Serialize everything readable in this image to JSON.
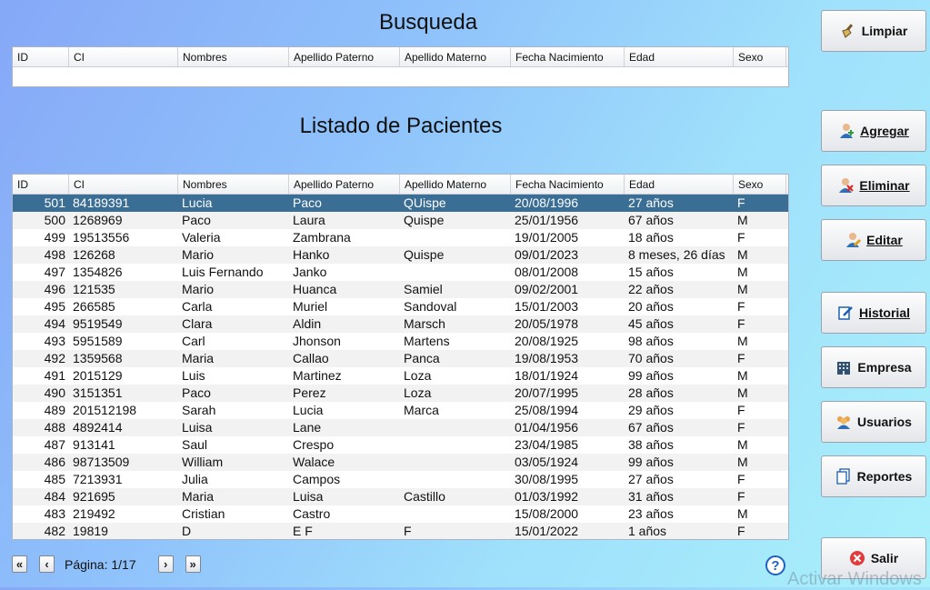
{
  "search": {
    "title": "Busqueda",
    "columns": [
      "ID",
      "CI",
      "Nombres",
      "Apellido Paterno",
      "Apellido Materno",
      "Fecha Nacimiento",
      "Edad",
      "Sexo"
    ]
  },
  "listing": {
    "title": "Listado de Pacientes",
    "columns": [
      "ID",
      "CI",
      "Nombres",
      "Apellido Paterno",
      "Apellido Materno",
      "Fecha Nacimiento",
      "Edad",
      "Sexo"
    ],
    "rows": [
      [
        "501",
        "84189391",
        "Lucia",
        "Paco",
        "QUispe",
        "20/08/1996",
        "27 años",
        "F"
      ],
      [
        "500",
        "1268969",
        "Paco",
        "Laura",
        "Quispe",
        "25/01/1956",
        "67 años",
        "M"
      ],
      [
        "499",
        "19513556",
        "Valeria",
        "Zambrana",
        "",
        "19/01/2005",
        "18 años",
        "F"
      ],
      [
        "498",
        "126268",
        "Mario",
        "Hanko",
        "Quispe",
        "09/01/2023",
        "8 meses, 26 días",
        "M"
      ],
      [
        "497",
        "1354826",
        "Luis Fernando",
        "Janko",
        "",
        "08/01/2008",
        "15 años",
        "M"
      ],
      [
        "496",
        "121535",
        "Mario",
        "Huanca",
        "Samiel",
        "09/02/2001",
        "22 años",
        "M"
      ],
      [
        "495",
        "266585",
        "Carla",
        "Muriel",
        "Sandoval",
        "15/01/2003",
        "20 años",
        "F"
      ],
      [
        "494",
        "9519549",
        "Clara",
        "Aldin",
        "Marsch",
        "20/05/1978",
        "45 años",
        "F"
      ],
      [
        "493",
        "5951589",
        "Carl",
        "Jhonson",
        "Martens",
        "20/08/1925",
        "98 años",
        "M"
      ],
      [
        "492",
        "1359568",
        "Maria",
        "Callao",
        "Panca",
        "19/08/1953",
        "70 años",
        "F"
      ],
      [
        "491",
        "2015129",
        "Luis",
        "Martinez",
        "Loza",
        "18/01/1924",
        "99 años",
        "M"
      ],
      [
        "490",
        "3151351",
        "Paco",
        "Perez",
        "Loza",
        "20/07/1995",
        "28 años",
        "M"
      ],
      [
        "489",
        "201512198",
        "Sarah",
        "Lucia",
        "Marca",
        "25/08/1994",
        "29 años",
        "F"
      ],
      [
        "488",
        "4892414",
        "Luisa",
        "Lane",
        "",
        "01/04/1956",
        "67 años",
        "F"
      ],
      [
        "487",
        "913141",
        "Saul",
        "Crespo",
        "",
        "23/04/1985",
        "38 años",
        "M"
      ],
      [
        "486",
        "98713509",
        "William",
        "Walace",
        "",
        "03/05/1924",
        "99 años",
        "M"
      ],
      [
        "485",
        "7213931",
        "Julia",
        "Campos",
        "",
        "30/08/1995",
        "27 años",
        "F"
      ],
      [
        "484",
        "921695",
        "Maria",
        "Luisa",
        "Castillo",
        "01/03/1992",
        "31 años",
        "F"
      ],
      [
        "483",
        "219492",
        "Cristian",
        "Castro",
        "",
        "15/08/2000",
        "23 años",
        "M"
      ],
      [
        "482",
        "19819",
        "D",
        "E F",
        "F",
        "15/01/2022",
        "1 años",
        "F"
      ]
    ],
    "selected_index": 0
  },
  "buttons": {
    "limpiar": "Limpiar",
    "agregar": "Agregar",
    "eliminar": "Eliminar",
    "editar": "Editar",
    "historial": "Historial",
    "empresa": "Empresa",
    "usuarios": "Usuarios",
    "reportes": "Reportes",
    "salir": "Salir"
  },
  "pager": {
    "label": "Página: 1/17"
  },
  "help": "?",
  "watermark": "Activar Windows"
}
